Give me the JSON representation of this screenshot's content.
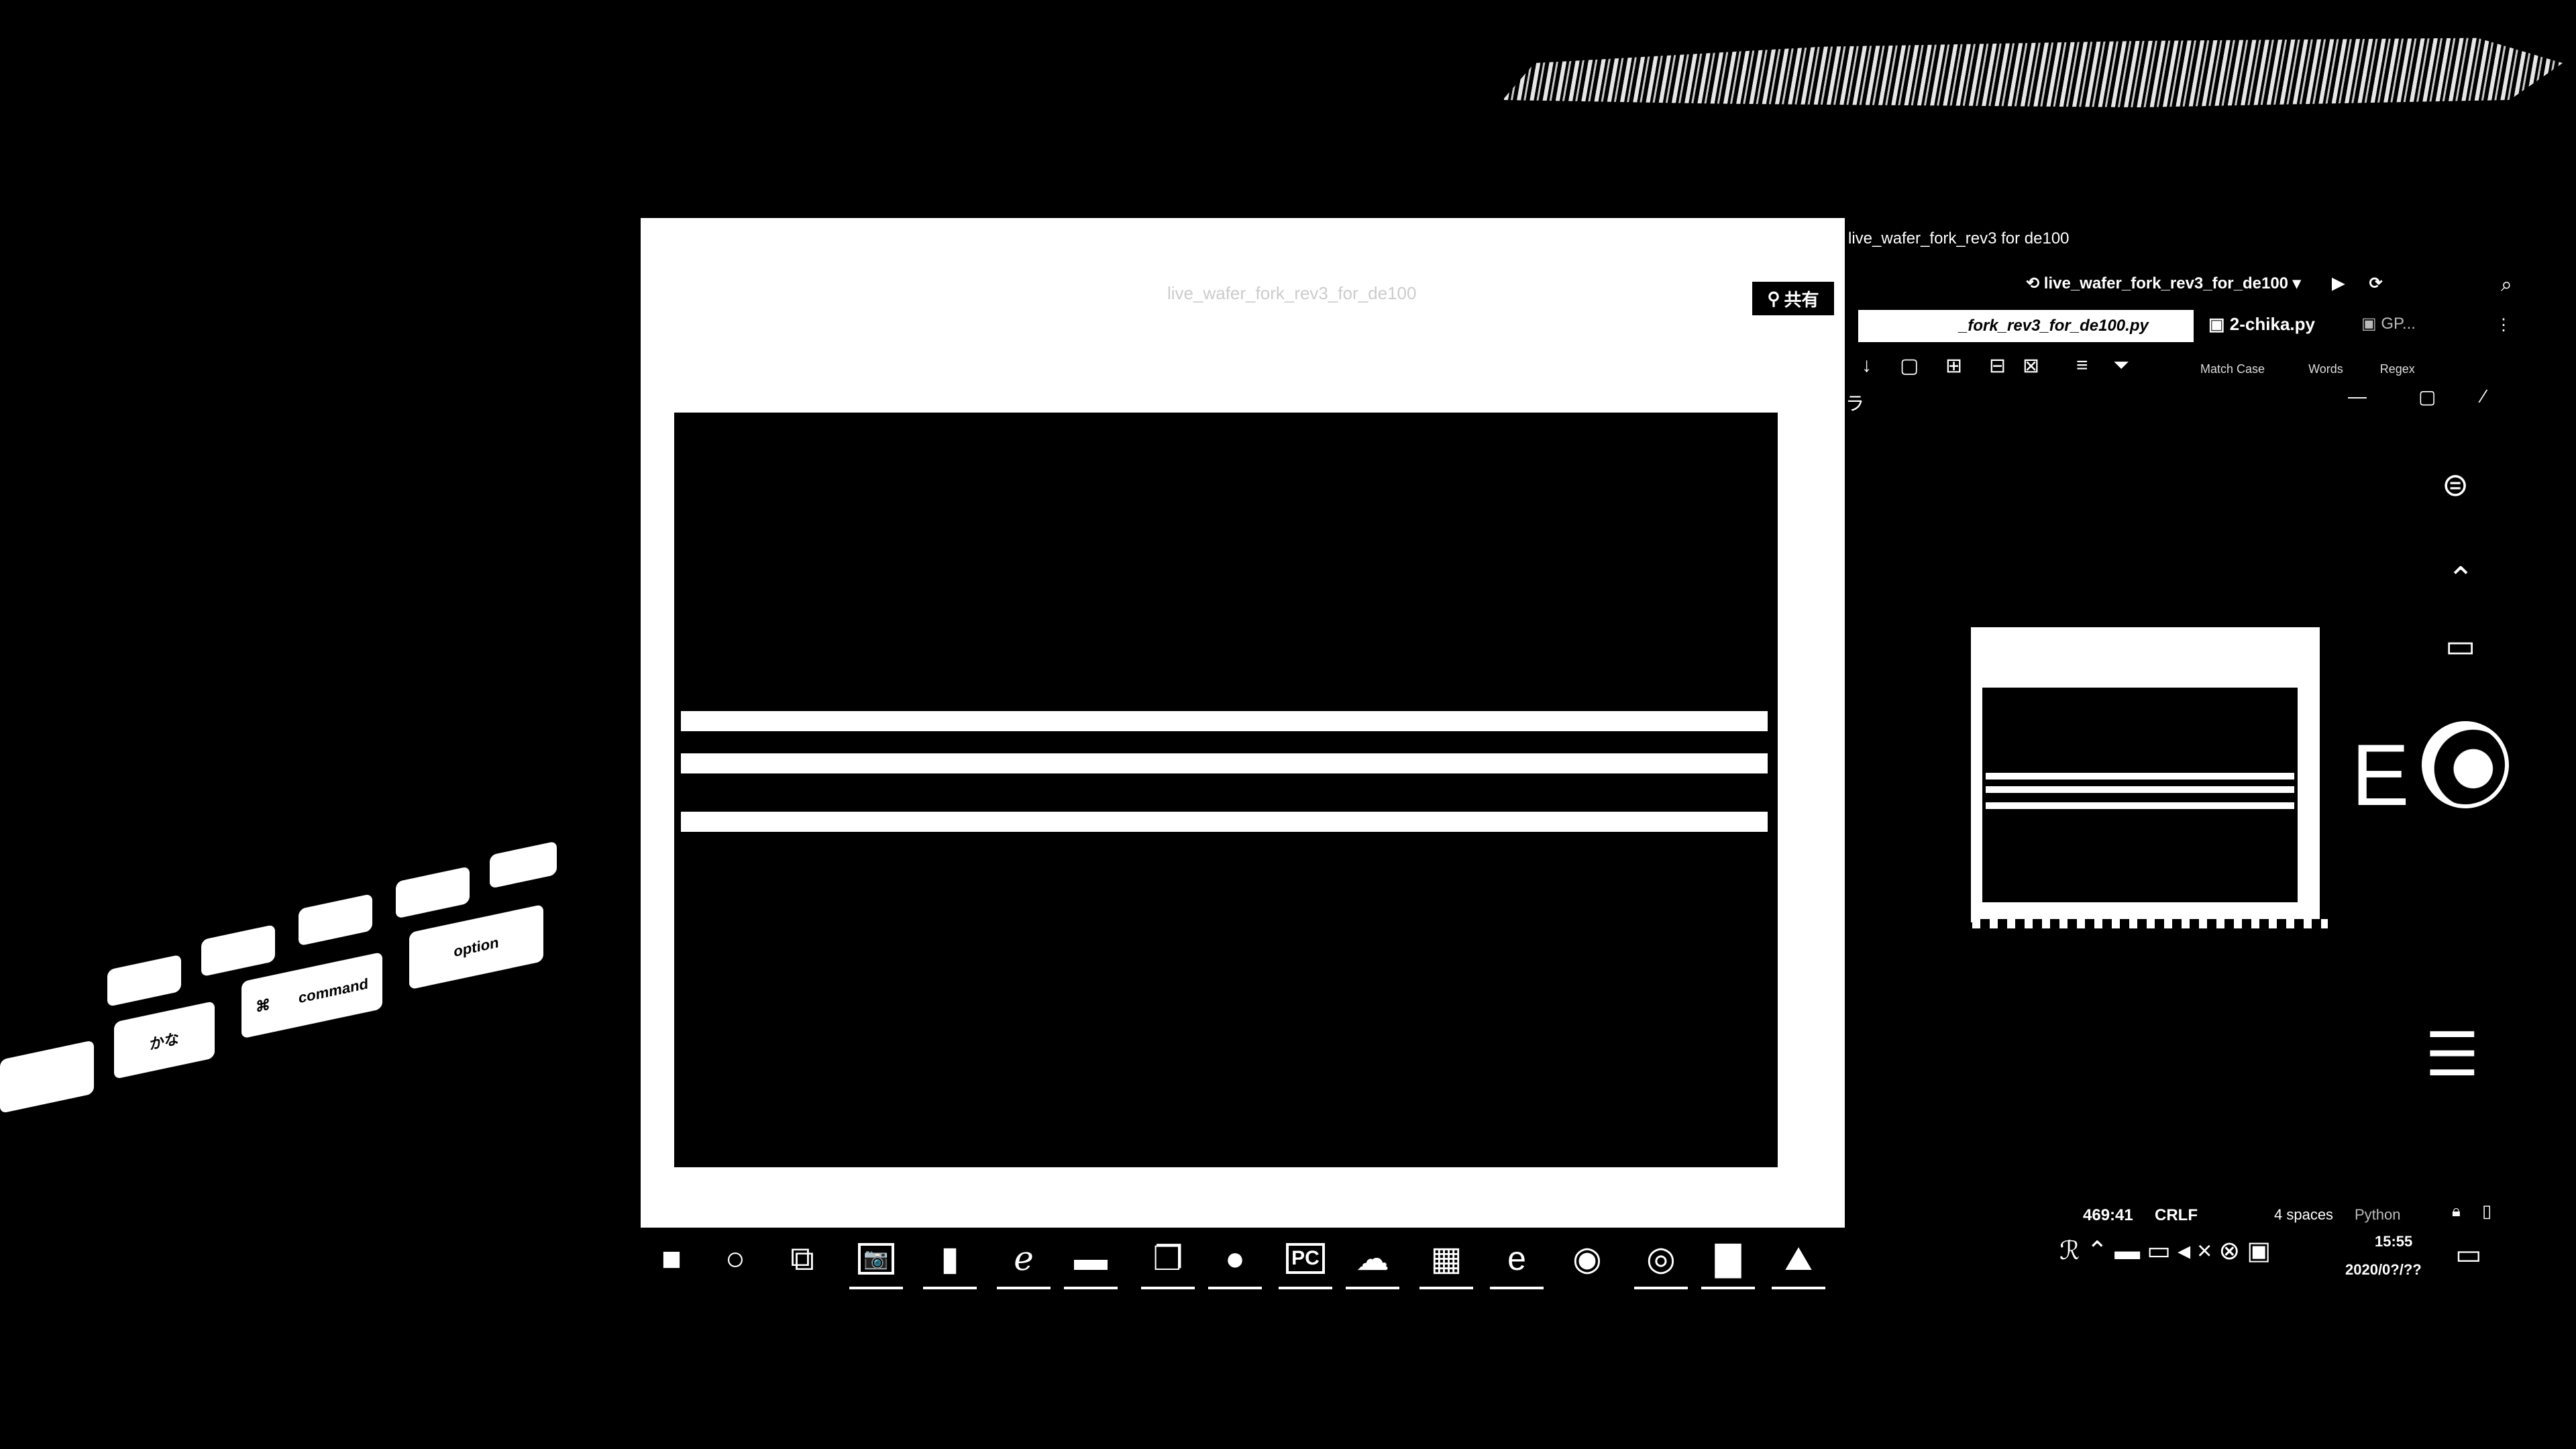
{
  "window": {
    "title": "live_wafer_fork_rev3_for_de100",
    "share_label": "共有",
    "share_icon": "person-icon"
  },
  "camera_app": {
    "title": "カメラ"
  },
  "ide": {
    "window_title": "live_wafer_fork_rev3 for de100",
    "run_config": "live_wafer_fork_rev3_for_de100",
    "tabs": [
      {
        "label": "_fork_rev3_for_de100.py"
      },
      {
        "label": "2-chika.py"
      },
      {
        "label": "GP..."
      }
    ],
    "find_options": [
      "Match Case",
      "Words",
      "Regex"
    ],
    "status": {
      "position": "469:41",
      "line_ending": "CRLF",
      "indent": "4 spaces",
      "language": "Python"
    }
  },
  "keyboard": {
    "keys": [
      "かな",
      "⌘",
      "command",
      "option"
    ]
  },
  "taskbar": {
    "items": [
      {
        "name": "windows-start",
        "icon": "start-icon",
        "glyph": "■"
      },
      {
        "name": "cortana-search",
        "icon": "circle-icon",
        "glyph": "○"
      },
      {
        "name": "task-view",
        "icon": "task-view-icon",
        "glyph": "⧉"
      },
      {
        "name": "camera",
        "icon": "camera-icon",
        "glyph": "📷"
      },
      {
        "name": "notebook",
        "icon": "book-icon",
        "glyph": "▮"
      },
      {
        "name": "internet-explorer",
        "icon": "ie-icon",
        "glyph": "ℯ"
      },
      {
        "name": "file-explorer",
        "icon": "folder-icon",
        "glyph": "▬"
      },
      {
        "name": "copy-app",
        "icon": "stacked-windows-icon",
        "glyph": "❐"
      },
      {
        "name": "chat-app",
        "icon": "chat-icon",
        "glyph": "●"
      },
      {
        "name": "pycharm",
        "icon": "pycharm-icon",
        "glyph": "PC"
      },
      {
        "name": "mushroom-app",
        "icon": "blob-icon",
        "glyph": "☁"
      },
      {
        "name": "calculator",
        "icon": "calculator-icon",
        "glyph": "▦"
      },
      {
        "name": "edge",
        "icon": "edge-icon",
        "glyph": "e"
      },
      {
        "name": "maps",
        "icon": "pin-icon",
        "glyph": "◉"
      },
      {
        "name": "chrome",
        "icon": "chrome-icon",
        "glyph": "◎"
      },
      {
        "name": "store",
        "icon": "bag-icon",
        "glyph": "▇"
      },
      {
        "name": "photos",
        "icon": "photo-icon",
        "glyph": "⛰"
      }
    ],
    "clock_time": "15:55",
    "clock_date": "2020/0?/??"
  }
}
